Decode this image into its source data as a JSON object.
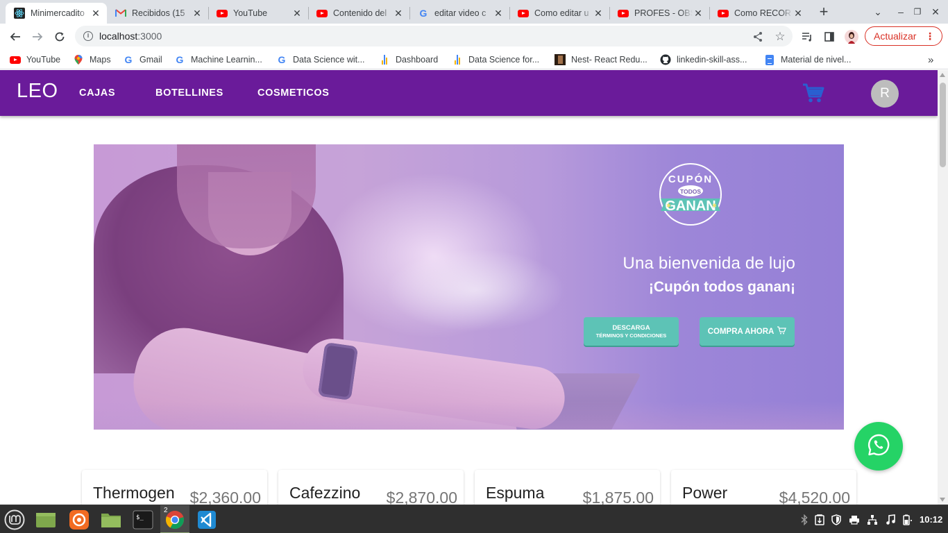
{
  "browser": {
    "tabs": [
      {
        "title": "Minimercadito",
        "active": true
      },
      {
        "title": "Recibidos (15"
      },
      {
        "title": "YouTube"
      },
      {
        "title": "Contenido del"
      },
      {
        "title": "editar video c"
      },
      {
        "title": "Como editar u"
      },
      {
        "title": "PROFES - OBS"
      },
      {
        "title": "Como RECOR"
      }
    ],
    "new_tab_symbol": "+",
    "url_host": "localhost",
    "url_port": ":3000",
    "update_button_label": "Actualizar",
    "bookmarks": [
      {
        "label": "YouTube",
        "icon": "youtube-icon"
      },
      {
        "label": "Maps",
        "icon": "maps-icon"
      },
      {
        "label": "Gmail",
        "icon": "google-icon"
      },
      {
        "label": "Machine Learnin...",
        "icon": "google-icon"
      },
      {
        "label": "Data Science wit...",
        "icon": "google-icon"
      },
      {
        "label": "Dashboard",
        "icon": "dashboard-icon"
      },
      {
        "label": "Data Science for...",
        "icon": "dashboard-icon"
      },
      {
        "label": "Nest- React Redu...",
        "icon": "video-thumbnail-icon"
      },
      {
        "label": "linkedin-skill-ass...",
        "icon": "github-icon"
      },
      {
        "label": "Material de nivel...",
        "icon": "google-docs-icon"
      }
    ],
    "bookmarks_overflow": "»"
  },
  "app": {
    "brand": "LEO",
    "nav": [
      "CAJAS",
      "BOTELLINES",
      "COSMETICOS"
    ],
    "avatar_initial": "R",
    "accent_color": "#6a1b9a"
  },
  "banner": {
    "coupon_top": "CUPÓN",
    "coupon_middle": "TODOS",
    "coupon_bottom": "GANAN",
    "headline": "Una bienvenida de lujo",
    "subheadline": "¡Cupón todos ganan¡",
    "button_download_line1": "DESCARGA",
    "button_download_line2": "TÉRMINOS Y CONDICIONES",
    "button_buy": "COMPRA AHORA"
  },
  "products": [
    {
      "name": "Thermogen",
      "price": "$2,360.00"
    },
    {
      "name": "Cafezzino",
      "price": "$2,870.00"
    },
    {
      "name": "Espuma",
      "price": "$1,875.00"
    },
    {
      "name": "Power",
      "price": "$4,520.00"
    }
  ],
  "taskbar": {
    "chrome_window_count": "2",
    "clock": "10:12"
  }
}
